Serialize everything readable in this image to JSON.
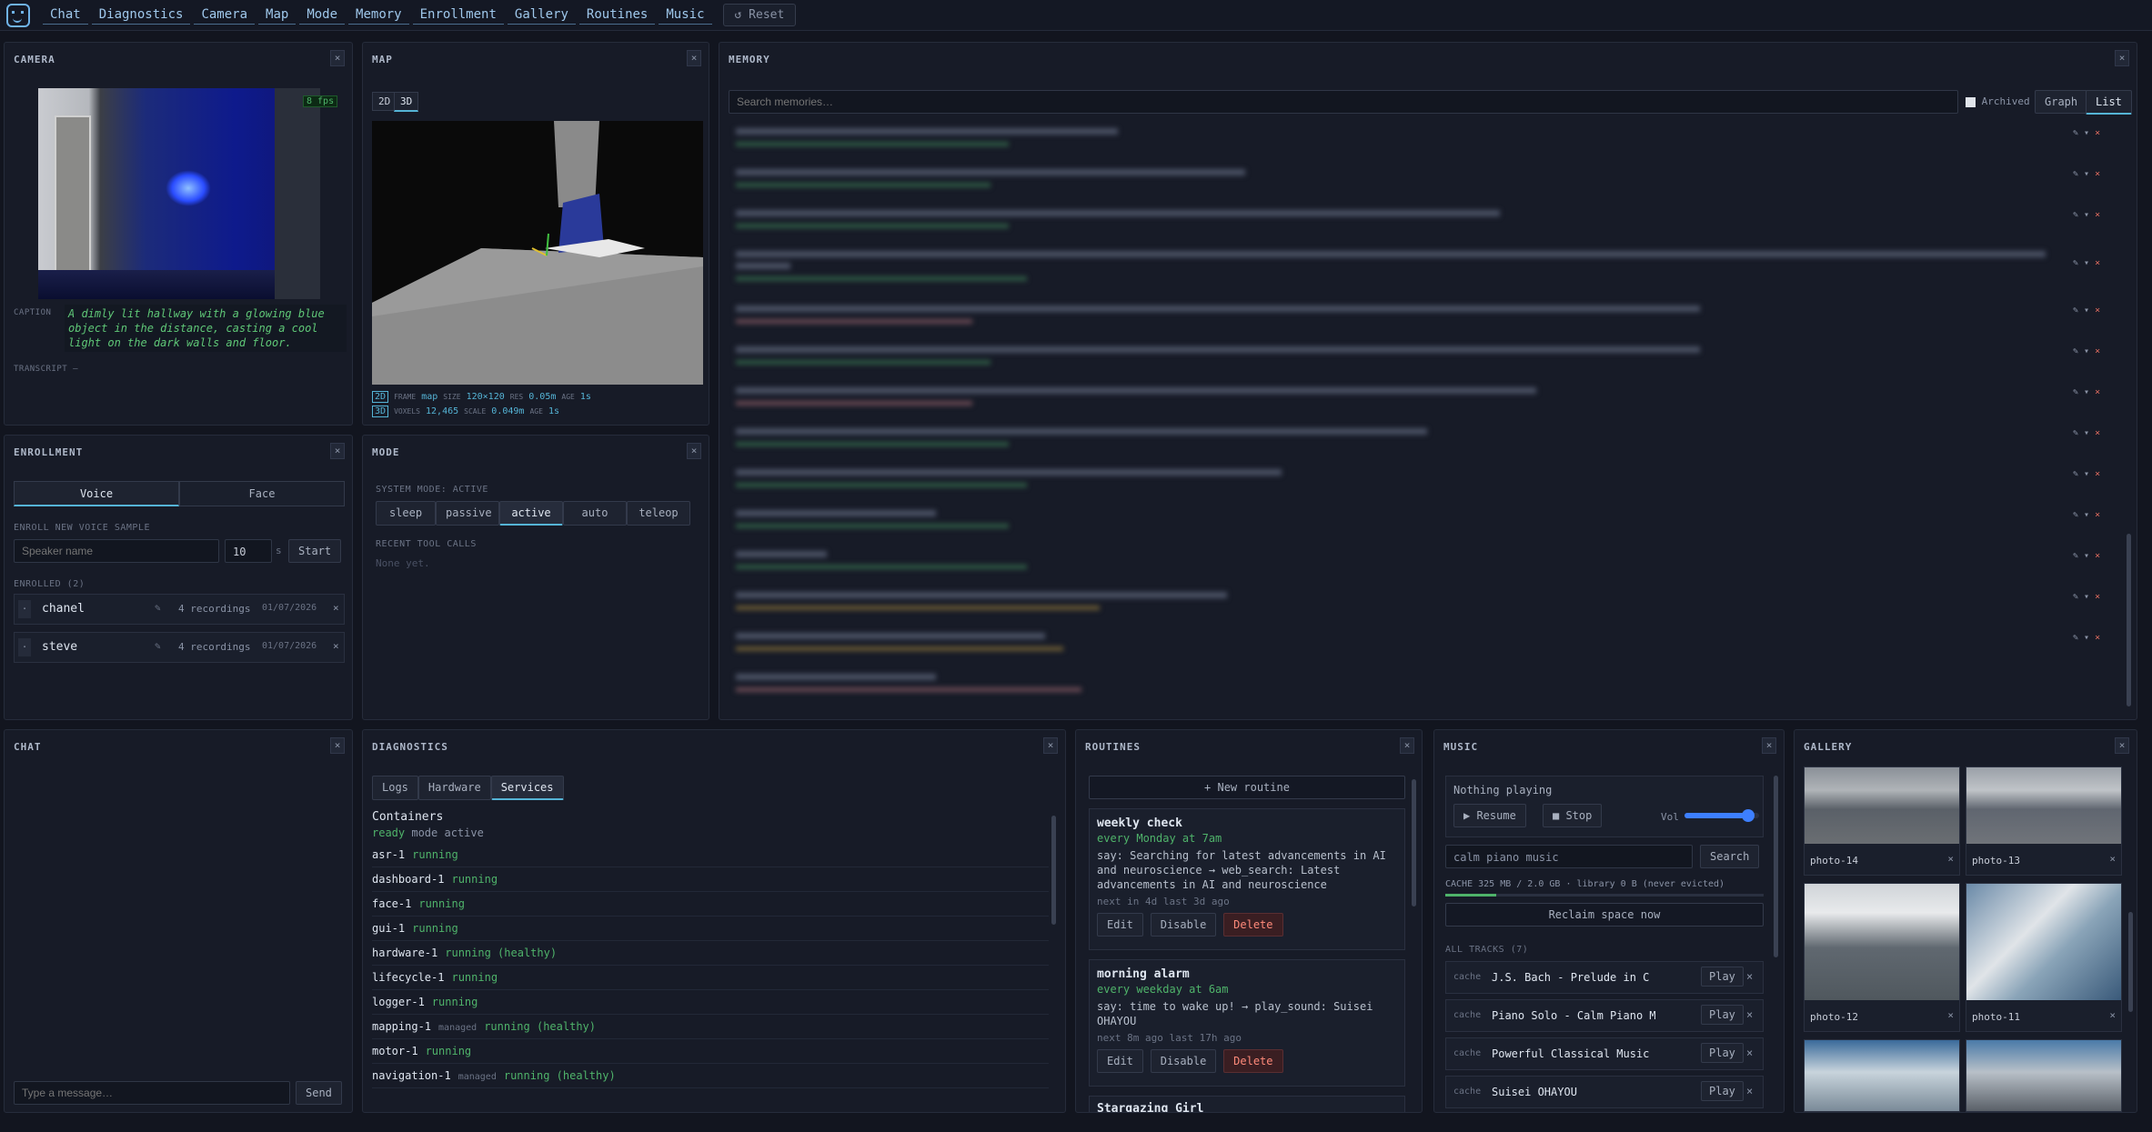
{
  "nav": {
    "items": [
      "Chat",
      "Diagnostics",
      "Camera",
      "Map",
      "Mode",
      "Memory",
      "Enrollment",
      "Gallery",
      "Routines",
      "Music"
    ],
    "reset": "↺ Reset"
  },
  "camera": {
    "title": "CAMERA",
    "fps": "8 fps",
    "caption_label": "CAPTION",
    "caption": "A dimly lit hallway with a glowing blue object in the distance, casting a cool light on the dark walls and floor.",
    "transcript_label": "TRANSCRIPT",
    "transcript": "—"
  },
  "map": {
    "title": "MAP",
    "tab2d": "2D",
    "tab3d": "3D",
    "row2d": {
      "badge": "2D",
      "l1": "FRAME",
      "v1": "map",
      "l2": "SIZE",
      "v2": "120×120",
      "l3": "RES",
      "v3": "0.05m",
      "l4": "AGE",
      "v4": "1s"
    },
    "row3d": {
      "badge": "3D",
      "l1": "VOXELS",
      "v1": "12,465",
      "l2": "SCALE",
      "v2": "0.049m",
      "l3": "AGE",
      "v3": "1s"
    }
  },
  "memory": {
    "title": "MEMORY",
    "search_placeholder": "Search memories…",
    "archived": "Archived",
    "graph": "Graph",
    "list": "List"
  },
  "enrollment": {
    "title": "ENROLLMENT",
    "tab_voice": "Voice",
    "tab_face": "Face",
    "new_label": "ENROLL NEW VOICE SAMPLE",
    "speaker_placeholder": "Speaker name",
    "seconds": "10",
    "s": "s",
    "start": "Start",
    "enrolled_label": "ENROLLED (2)",
    "people": [
      {
        "name": "chanel",
        "count": "4 recordings",
        "date": "01/07/2026"
      },
      {
        "name": "steve",
        "count": "4 recordings",
        "date": "01/07/2026"
      }
    ]
  },
  "mode": {
    "title": "MODE",
    "system_mode": "SYSTEM MODE: ACTIVE",
    "modes": [
      "sleep",
      "passive",
      "active",
      "auto",
      "teleop"
    ],
    "recent_label": "RECENT TOOL CALLS",
    "none": "None yet."
  },
  "chat": {
    "title": "CHAT",
    "placeholder": "Type a message…",
    "send": "Send"
  },
  "diagnostics": {
    "title": "DIAGNOSTICS",
    "tabs": [
      "Logs",
      "Hardware",
      "Services"
    ],
    "containers": "Containers",
    "ready": "ready",
    "mode_active": "mode active",
    "services": [
      {
        "name": "asr-1",
        "tag": "",
        "status": "running"
      },
      {
        "name": "dashboard-1",
        "tag": "",
        "status": "running"
      },
      {
        "name": "face-1",
        "tag": "",
        "status": "running"
      },
      {
        "name": "gui-1",
        "tag": "",
        "status": "running"
      },
      {
        "name": "hardware-1",
        "tag": "",
        "status": "running (healthy)"
      },
      {
        "name": "lifecycle-1",
        "tag": "",
        "status": "running"
      },
      {
        "name": "logger-1",
        "tag": "",
        "status": "running"
      },
      {
        "name": "mapping-1",
        "tag": "managed",
        "status": "running (healthy)"
      },
      {
        "name": "motor-1",
        "tag": "",
        "status": "running"
      },
      {
        "name": "navigation-1",
        "tag": "managed",
        "status": "running (healthy)"
      }
    ]
  },
  "routines": {
    "title": "ROUTINES",
    "new": "+ New routine",
    "items": [
      {
        "name": "weekly check",
        "schedule": "every Monday at 7am",
        "desc": "say: Searching for latest advancements in AI and neuroscience → web_search: Latest advancements in AI and neuroscience",
        "meta": "next in 4d  last 3d ago"
      },
      {
        "name": "morning alarm",
        "schedule": "every weekday at 6am",
        "desc": "say: time to wake up! → play_sound: Suisei OHAYOU",
        "meta": "next 8m ago  last 17h ago"
      },
      {
        "name": "Stargazing Girl",
        "schedule": "",
        "desc": "",
        "meta": ""
      }
    ],
    "edit": "Edit",
    "disable": "Disable",
    "delete": "Delete"
  },
  "music": {
    "title": "MUSIC",
    "nothing": "Nothing playing",
    "resume": "▶ Resume",
    "stop": "■ Stop",
    "vol": "Vol",
    "volume": 0.85,
    "search_value": "calm piano music",
    "search": "Search",
    "cache": "CACHE 325 MB / 2.0 GB · library 0 B (never evicted)",
    "cache_fraction": 0.16,
    "reclaim": "Reclaim space now",
    "all_tracks": "ALL TRACKS (7)",
    "play": "Play",
    "cache_tag": "cache",
    "tracks": [
      "J.S. Bach - Prelude in C Ma…",
      "Piano Solo - Calm Piano Mus…",
      "Powerful Classical Music",
      "Suisei OHAYOU"
    ]
  },
  "gallery": {
    "title": "GALLERY",
    "photos": [
      "photo-14",
      "photo-13",
      "photo-12",
      "photo-11"
    ]
  },
  "colors": {
    "accent": "#55b4d6",
    "green": "#4fb36a",
    "red": "#e06c5f",
    "bg": "#12151f"
  }
}
